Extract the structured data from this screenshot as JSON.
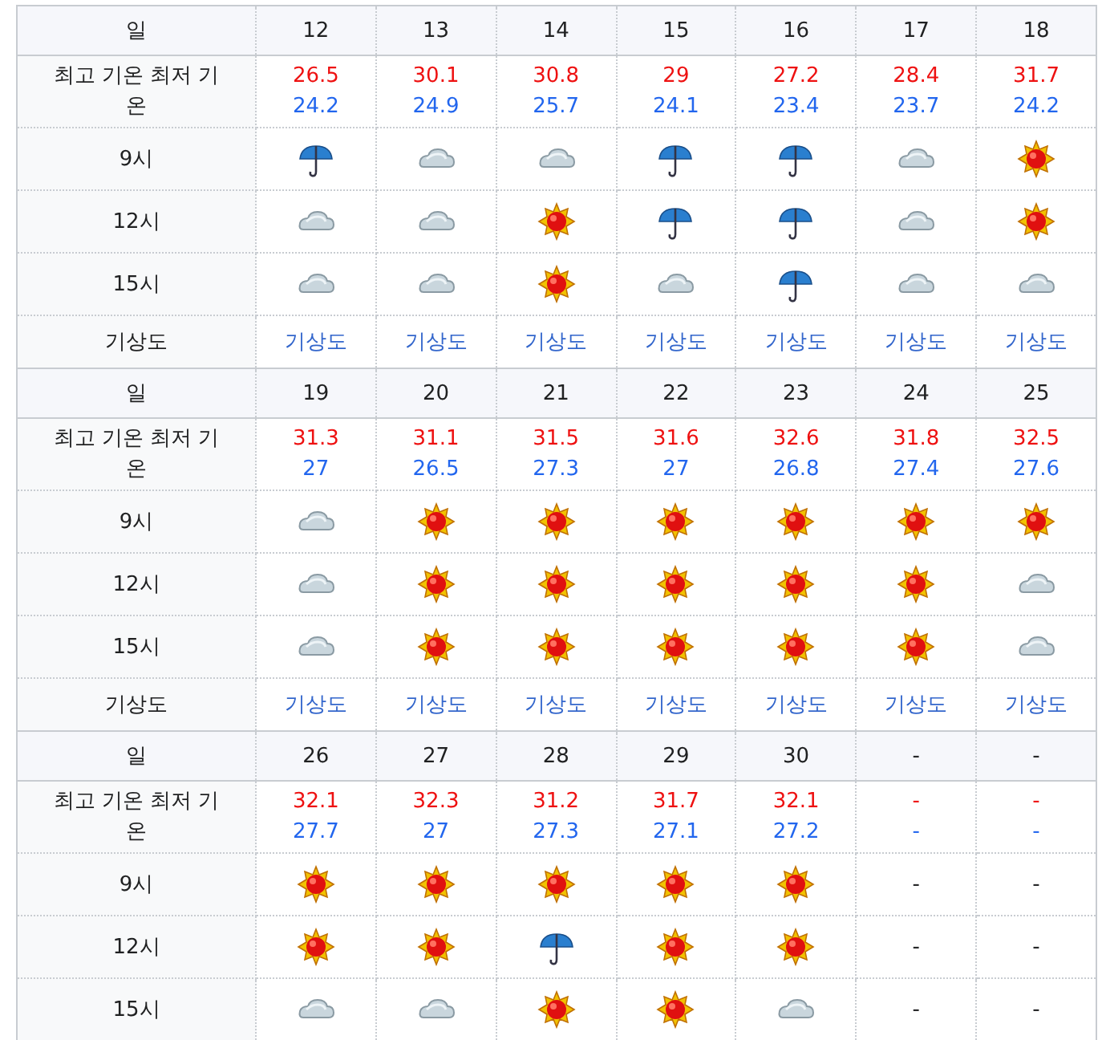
{
  "blocks": [
    {
      "labels": {
        "day": "일",
        "temp": "최고 기온 최저 기온",
        "h9": "9시",
        "h12": "12시",
        "h15": "15시",
        "map": "기상도"
      },
      "days": [
        {
          "day": "12",
          "high": "26.5",
          "low": "24.2",
          "h9": {
            "kind": "rain"
          },
          "h12": {
            "kind": "cloud"
          },
          "h15": {
            "kind": "cloud"
          },
          "map": "기상도"
        },
        {
          "day": "13",
          "high": "30.1",
          "low": "24.9",
          "h9": {
            "kind": "cloud"
          },
          "h12": {
            "kind": "cloud"
          },
          "h15": {
            "kind": "cloud"
          },
          "map": "기상도"
        },
        {
          "day": "14",
          "high": "30.8",
          "low": "25.7",
          "h9": {
            "kind": "cloud"
          },
          "h12": {
            "kind": "sun"
          },
          "h15": {
            "kind": "sun"
          },
          "map": "기상도"
        },
        {
          "day": "15",
          "high": "29",
          "low": "24.1",
          "h9": {
            "kind": "rain"
          },
          "h12": {
            "kind": "rain"
          },
          "h15": {
            "kind": "cloud"
          },
          "map": "기상도"
        },
        {
          "day": "16",
          "high": "27.2",
          "low": "23.4",
          "h9": {
            "kind": "rain"
          },
          "h12": {
            "kind": "rain"
          },
          "h15": {
            "kind": "rain"
          },
          "map": "기상도"
        },
        {
          "day": "17",
          "high": "28.4",
          "low": "23.7",
          "h9": {
            "kind": "cloud"
          },
          "h12": {
            "kind": "cloud"
          },
          "h15": {
            "kind": "cloud"
          },
          "map": "기상도"
        },
        {
          "day": "18",
          "high": "31.7",
          "low": "24.2",
          "h9": {
            "kind": "sun"
          },
          "h12": {
            "kind": "sun"
          },
          "h15": {
            "kind": "cloud"
          },
          "map": "기상도"
        }
      ]
    },
    {
      "labels": {
        "day": "일",
        "temp": "최고 기온 최저 기온",
        "h9": "9시",
        "h12": "12시",
        "h15": "15시",
        "map": "기상도"
      },
      "days": [
        {
          "day": "19",
          "high": "31.3",
          "low": "27",
          "h9": {
            "kind": "cloud"
          },
          "h12": {
            "kind": "cloud"
          },
          "h15": {
            "kind": "cloud"
          },
          "map": "기상도"
        },
        {
          "day": "20",
          "high": "31.1",
          "low": "26.5",
          "h9": {
            "kind": "sun"
          },
          "h12": {
            "kind": "sun"
          },
          "h15": {
            "kind": "sun"
          },
          "map": "기상도"
        },
        {
          "day": "21",
          "high": "31.5",
          "low": "27.3",
          "h9": {
            "kind": "sun"
          },
          "h12": {
            "kind": "sun"
          },
          "h15": {
            "kind": "sun"
          },
          "map": "기상도"
        },
        {
          "day": "22",
          "high": "31.6",
          "low": "27",
          "h9": {
            "kind": "sun"
          },
          "h12": {
            "kind": "sun"
          },
          "h15": {
            "kind": "sun"
          },
          "map": "기상도"
        },
        {
          "day": "23",
          "high": "32.6",
          "low": "26.8",
          "h9": {
            "kind": "sun"
          },
          "h12": {
            "kind": "sun"
          },
          "h15": {
            "kind": "sun"
          },
          "map": "기상도"
        },
        {
          "day": "24",
          "high": "31.8",
          "low": "27.4",
          "h9": {
            "kind": "sun"
          },
          "h12": {
            "kind": "sun"
          },
          "h15": {
            "kind": "sun"
          },
          "map": "기상도"
        },
        {
          "day": "25",
          "high": "32.5",
          "low": "27.6",
          "h9": {
            "kind": "sun"
          },
          "h12": {
            "kind": "cloud"
          },
          "h15": {
            "kind": "cloud"
          },
          "map": "기상도"
        }
      ]
    },
    {
      "labels": {
        "day": "일",
        "temp": "최고 기온 최저 기온",
        "h9": "9시",
        "h12": "12시",
        "h15": "15시"
      },
      "days": [
        {
          "day": "26",
          "high": "32.1",
          "low": "27.7",
          "h9": {
            "kind": "sun"
          },
          "h12": {
            "kind": "sun"
          },
          "h15": {
            "kind": "cloud"
          }
        },
        {
          "day": "27",
          "high": "32.3",
          "low": "27",
          "h9": {
            "kind": "sun"
          },
          "h12": {
            "kind": "sun"
          },
          "h15": {
            "kind": "cloud"
          }
        },
        {
          "day": "28",
          "high": "31.2",
          "low": "27.3",
          "h9": {
            "kind": "sun"
          },
          "h12": {
            "kind": "rain"
          },
          "h15": {
            "kind": "sun"
          }
        },
        {
          "day": "29",
          "high": "31.7",
          "low": "27.1",
          "h9": {
            "kind": "sun"
          },
          "h12": {
            "kind": "sun"
          },
          "h15": {
            "kind": "sun"
          }
        },
        {
          "day": "30",
          "high": "32.1",
          "low": "27.2",
          "h9": {
            "kind": "sun"
          },
          "h12": {
            "kind": "sun"
          },
          "h15": {
            "kind": "cloud"
          }
        },
        {
          "day": "-",
          "high": "-",
          "low": "-",
          "h9": {
            "kind": "text",
            "text": "-"
          },
          "h12": {
            "kind": "text",
            "text": "-"
          },
          "h15": {
            "kind": "text",
            "text": "-"
          }
        },
        {
          "day": "-",
          "high": "-",
          "low": "-",
          "h9": {
            "kind": "text",
            "text": "-"
          },
          "h12": {
            "kind": "text",
            "text": "-"
          },
          "h15": {
            "kind": "text",
            "text": "-"
          }
        }
      ]
    }
  ]
}
